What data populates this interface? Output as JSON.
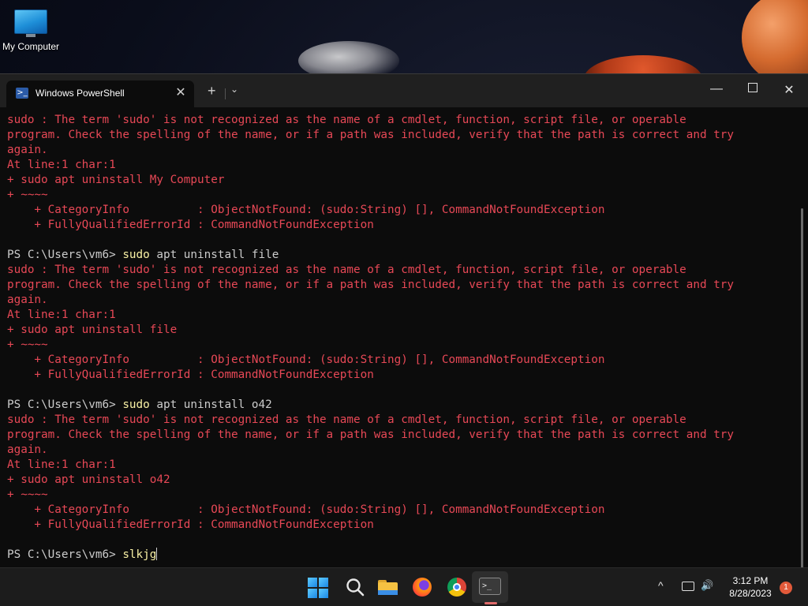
{
  "desktop": {
    "icons": [
      {
        "label": "My Computer",
        "icon": "computer-icon"
      }
    ]
  },
  "window": {
    "tab_title": "Windows PowerShell",
    "tab_icon": "powershell-icon",
    "tab_close_glyph": "✕",
    "new_tab_glyph": "+",
    "dropdown_glyph": "⌄",
    "minimize_glyph": "—",
    "close_glyph": "✕"
  },
  "console": {
    "lines": [
      {
        "type": "err",
        "text": "sudo : The term 'sudo' is not recognized as the name of a cmdlet, function, script file, or operable"
      },
      {
        "type": "err",
        "text": "program. Check the spelling of the name, or if a path was included, verify that the path is correct and try"
      },
      {
        "type": "err",
        "text": "again."
      },
      {
        "type": "err",
        "text": "At line:1 char:1"
      },
      {
        "type": "err",
        "text": "+ sudo apt uninstall My Computer"
      },
      {
        "type": "err",
        "text": "+ ~~~~"
      },
      {
        "type": "err",
        "text": "    + CategoryInfo          : ObjectNotFound: (sudo:String) [], CommandNotFoundException"
      },
      {
        "type": "err",
        "text": "    + FullyQualifiedErrorId : CommandNotFoundException"
      },
      {
        "type": "blank",
        "text": ""
      },
      {
        "type": "prompt",
        "prompt": "PS C:\\Users\\vm6> ",
        "cmd": "sudo",
        "args": " apt uninstall file"
      },
      {
        "type": "err",
        "text": "sudo : The term 'sudo' is not recognized as the name of a cmdlet, function, script file, or operable"
      },
      {
        "type": "err",
        "text": "program. Check the spelling of the name, or if a path was included, verify that the path is correct and try"
      },
      {
        "type": "err",
        "text": "again."
      },
      {
        "type": "err",
        "text": "At line:1 char:1"
      },
      {
        "type": "err",
        "text": "+ sudo apt uninstall file"
      },
      {
        "type": "err",
        "text": "+ ~~~~"
      },
      {
        "type": "err",
        "text": "    + CategoryInfo          : ObjectNotFound: (sudo:String) [], CommandNotFoundException"
      },
      {
        "type": "err",
        "text": "    + FullyQualifiedErrorId : CommandNotFoundException"
      },
      {
        "type": "blank",
        "text": ""
      },
      {
        "type": "prompt",
        "prompt": "PS C:\\Users\\vm6> ",
        "cmd": "sudo",
        "args": " apt uninstall o42"
      },
      {
        "type": "err",
        "text": "sudo : The term 'sudo' is not recognized as the name of a cmdlet, function, script file, or operable"
      },
      {
        "type": "err",
        "text": "program. Check the spelling of the name, or if a path was included, verify that the path is correct and try"
      },
      {
        "type": "err",
        "text": "again."
      },
      {
        "type": "err",
        "text": "At line:1 char:1"
      },
      {
        "type": "err",
        "text": "+ sudo apt uninstall o42"
      },
      {
        "type": "err",
        "text": "+ ~~~~"
      },
      {
        "type": "err",
        "text": "    + CategoryInfo          : ObjectNotFound: (sudo:String) [], CommandNotFoundException"
      },
      {
        "type": "err",
        "text": "    + FullyQualifiedErrorId : CommandNotFoundException"
      },
      {
        "type": "blank",
        "text": ""
      },
      {
        "type": "input",
        "prompt": "PS C:\\Users\\vm6> ",
        "cmd": "slkjg",
        "args": ""
      }
    ],
    "colors": {
      "error": "#e74856",
      "text": "#cccccc",
      "command": "#f9f1a5",
      "background": "#0c0c0c"
    }
  },
  "taskbar": {
    "apps": [
      {
        "name": "start",
        "icon": "windows-logo-icon"
      },
      {
        "name": "search",
        "icon": "search-icon"
      },
      {
        "name": "file-explorer",
        "icon": "folder-icon"
      },
      {
        "name": "firefox",
        "icon": "firefox-icon"
      },
      {
        "name": "chrome",
        "icon": "chrome-icon"
      },
      {
        "name": "terminal",
        "icon": "terminal-icon",
        "active": true
      }
    ],
    "tray": {
      "chevron_glyph": "^",
      "volume_glyph": "🔊",
      "time": "3:12 PM",
      "date": "8/28/2023",
      "notification_count": "1"
    }
  }
}
